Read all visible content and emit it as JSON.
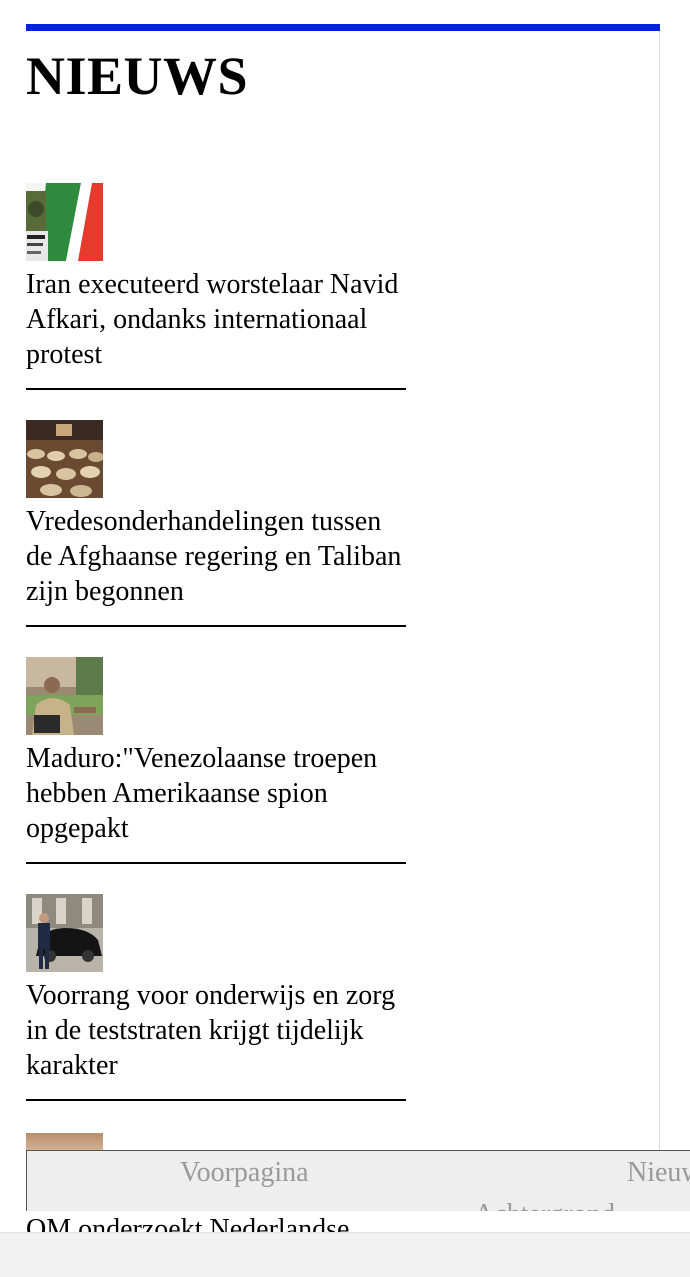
{
  "section": {
    "title": "NIEUWS"
  },
  "colors": {
    "accent_bar": "#0022e6",
    "nav_background": "#eeeeee",
    "nav_text": "#9a9a9a"
  },
  "articles": [
    {
      "headline": "Iran executeerd worstelaar Navid Afkari, ondanks internationaal protest",
      "thumbnail": "iran-flag-photo"
    },
    {
      "headline": "Vredesonderhandelingen tussen de Afghaanse regering en Taliban zijn begonnen",
      "thumbnail": "conference-hall-photo"
    },
    {
      "headline": "Maduro:\"Venezolaanse troepen hebben Amerikaanse spion opgepakt",
      "thumbnail": "maduro-podium-photo"
    },
    {
      "headline": "Voorrang voor onderwijs en zorg in de teststraten krijgt tijdelijk karakter",
      "thumbnail": "man-with-car-photo"
    }
  ],
  "partial_article": {
    "headline": "OM onderzoekt Nederlandse"
  },
  "bottom_nav": {
    "items": [
      "Voorpagina",
      "Nieuws",
      "Achtergrond"
    ]
  }
}
